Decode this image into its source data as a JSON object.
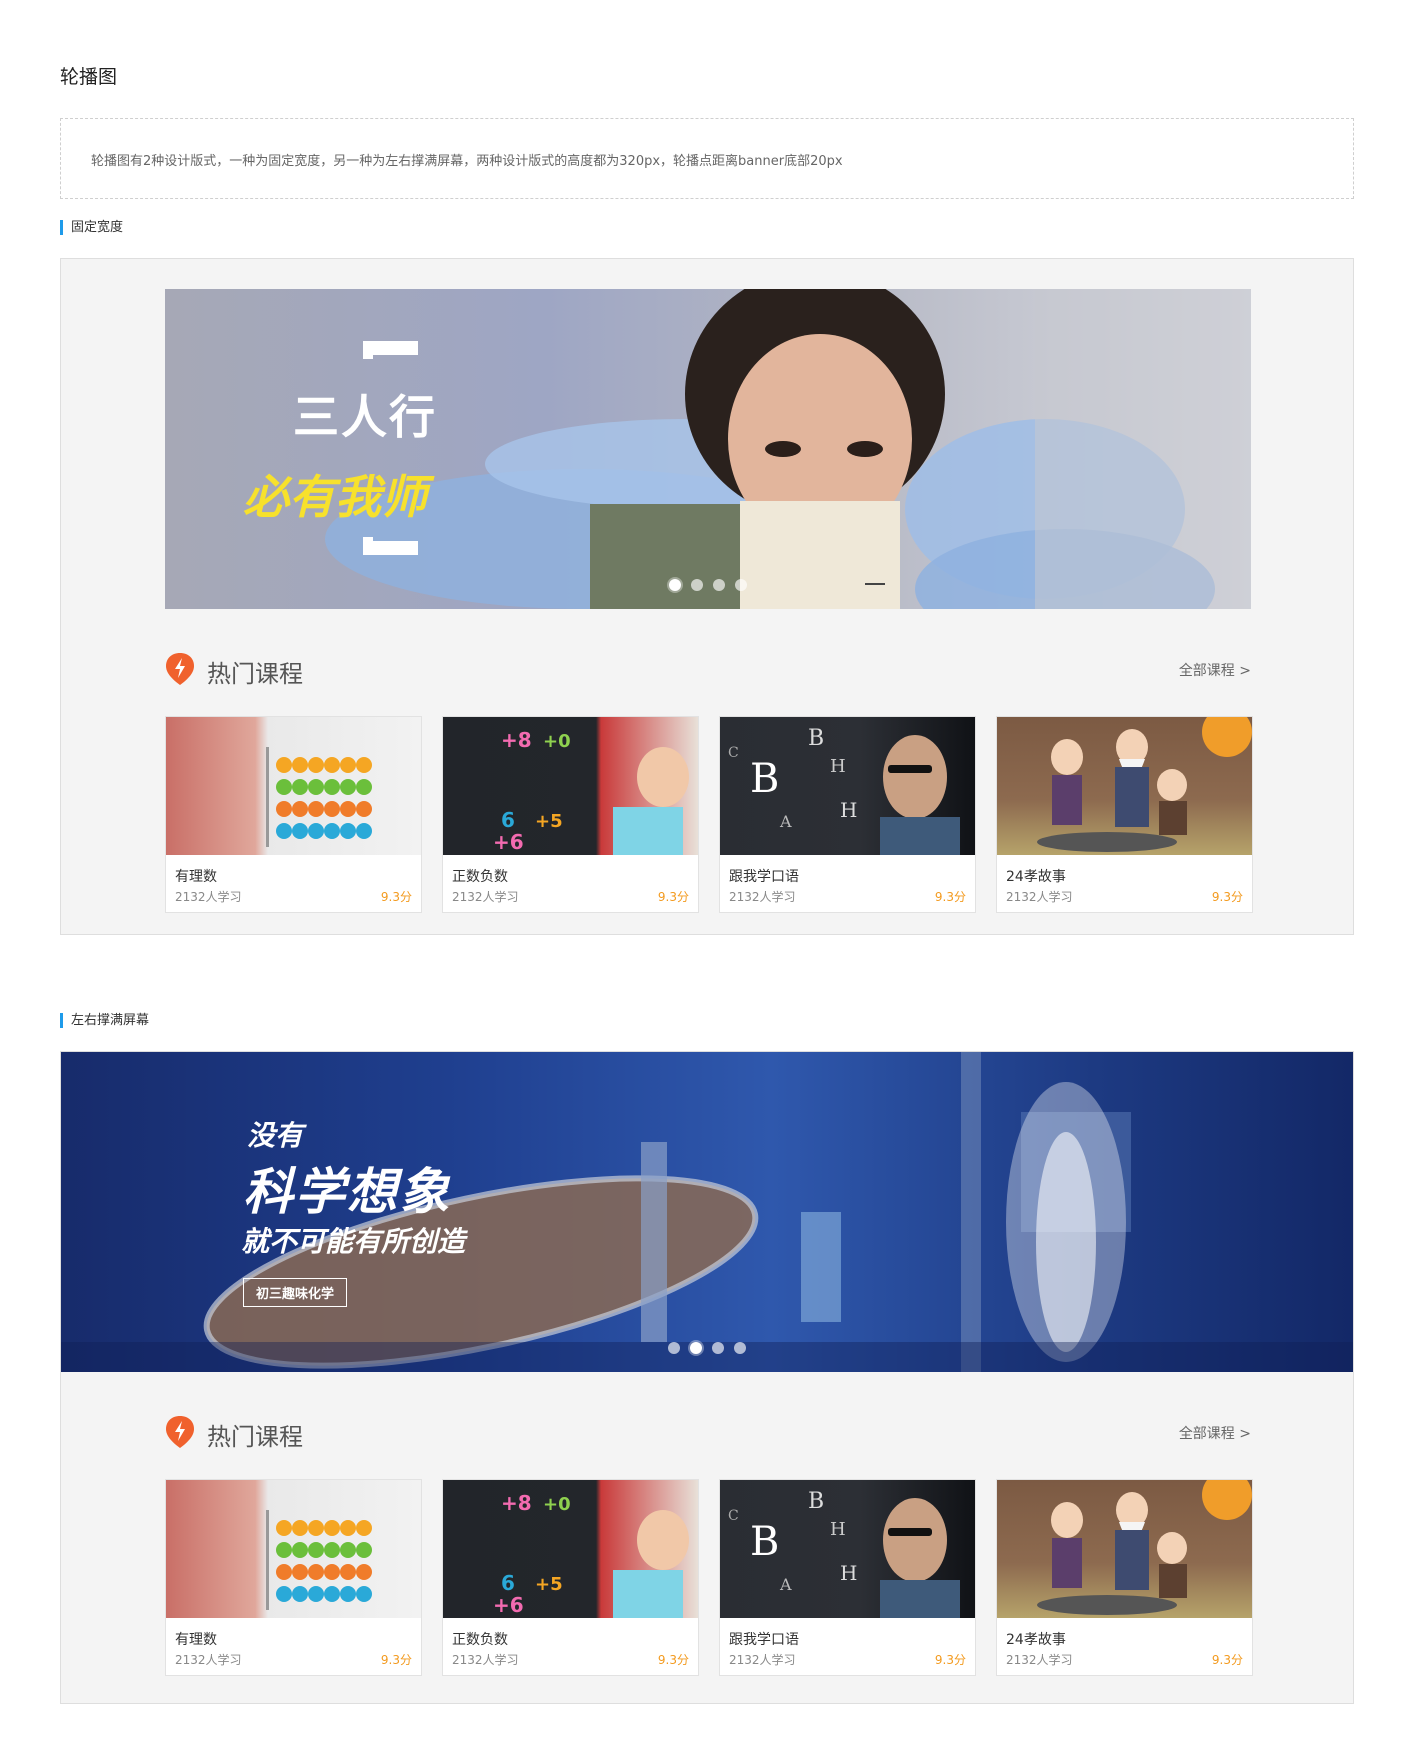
{
  "page": {
    "title": "轮播图",
    "description": "轮播图有2种设计版式，一种为固定宽度，另一种为左右撑满屏幕，两种设计版式的高度都为320px，轮播点距离banner底部20px"
  },
  "colors": {
    "accent": "#1e9bea",
    "score": "#f39a1e",
    "frame_bg": "#f4f4f4",
    "hot_icon": "#f0612d"
  },
  "sections": [
    {
      "label": "固定宽度",
      "banner": {
        "slogan_line1": "三人行",
        "slogan_line2": "必有我师",
        "dots": 4,
        "active_dot": 1
      },
      "hot": {
        "title": "热门课程",
        "all_link": "全部课程 >"
      },
      "courses": [
        {
          "title": "有理数",
          "count": "2132人学习",
          "score": "9.3分"
        },
        {
          "title": "正数负数",
          "count": "2132人学习",
          "score": "9.3分"
        },
        {
          "title": "跟我学口语",
          "count": "2132人学习",
          "score": "9.3分"
        },
        {
          "title": "24孝故事",
          "count": "2132人学习",
          "score": "9.3分"
        }
      ]
    },
    {
      "label": "左右撑满屏幕",
      "banner": {
        "slogan_line1": "没有",
        "slogan_line2": "科学想象",
        "slogan_line3": "就不可能有所创造",
        "badge": "初三趣味化学",
        "dots": 4,
        "active_dot": 2
      },
      "hot": {
        "title": "热门课程",
        "all_link": "全部课程 >"
      },
      "courses": [
        {
          "title": "有理数",
          "count": "2132人学习",
          "score": "9.3分"
        },
        {
          "title": "正数负数",
          "count": "2132人学习",
          "score": "9.3分"
        },
        {
          "title": "跟我学口语",
          "count": "2132人学习",
          "score": "9.3分"
        },
        {
          "title": "24孝故事",
          "count": "2132人学习",
          "score": "9.3分"
        }
      ]
    }
  ]
}
